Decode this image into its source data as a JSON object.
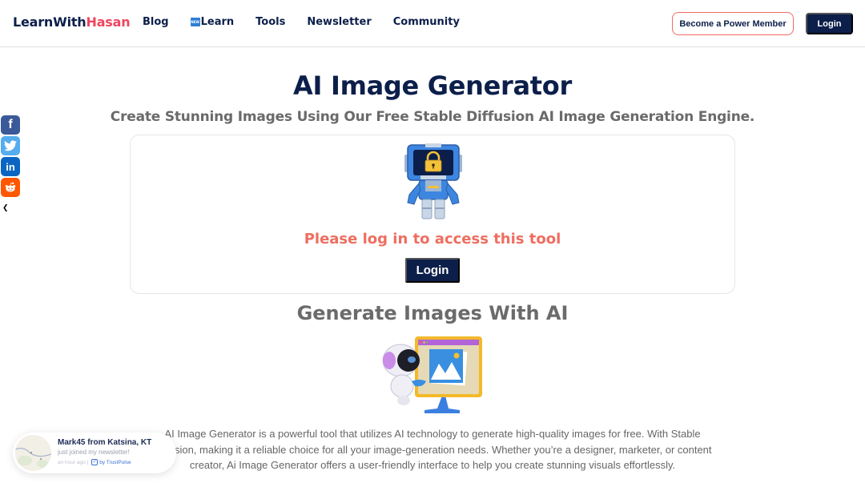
{
  "header": {
    "logo_part1": "LearnWith",
    "logo_part2": "Hasan",
    "nav": [
      {
        "label": "Blog"
      },
      {
        "label": "Learn",
        "badge": "NEW"
      },
      {
        "label": "Tools"
      },
      {
        "label": "Newsletter"
      },
      {
        "label": "Community"
      }
    ],
    "power_member_label": "Become a Power Member",
    "login_label": "Login"
  },
  "social": {
    "items": [
      {
        "name": "facebook",
        "glyph": "f"
      },
      {
        "name": "twitter",
        "glyph": "t"
      },
      {
        "name": "linkedin",
        "glyph": "in"
      },
      {
        "name": "reddit",
        "glyph": "r"
      }
    ],
    "hide_glyph": "❮"
  },
  "main": {
    "title": "AI Image Generator",
    "subtitle": "Create Stunning Images Using Our Free Stable Diffusion AI Image Generation Engine.",
    "card": {
      "message": "Please log in to access this tool",
      "login_label": "Login"
    },
    "section_title": "Generate Images With AI",
    "description": "AI Image Generator is a powerful tool that utilizes AI technology to generate high-quality images for free. With Stable Diffusion, making it a reliable choice for all your image-generation needs. Whether you’re a designer, marketer, or content creator, Ai Image Generator offers a user-friendly interface to help you create stunning visuals effortlessly."
  },
  "toast": {
    "name": "Mark45 from Katsina, KT",
    "action": "just joined my newsletter!",
    "time": "an hour ago |",
    "provider": "by TrustPulse"
  },
  "colors": {
    "navy": "#0c1f4a",
    "brand_red": "#f0455f",
    "coral": "#ee6e60",
    "gray_text": "#6b6b6b"
  }
}
